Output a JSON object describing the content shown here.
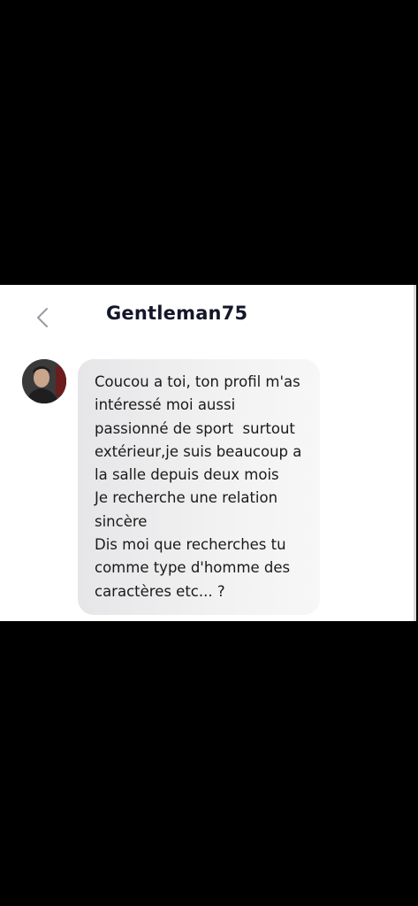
{
  "header": {
    "title": "Gentleman75",
    "back_icon": "chevron-left-icon"
  },
  "colors": {
    "page_background": "#000000",
    "panel_background": "#ffffff",
    "bubble_background": "#eeeeef",
    "title_color": "#14172a",
    "back_icon_color": "#9a9aa2"
  },
  "message": {
    "sender_avatar": "avatar",
    "lines": [
      "Coucou a toi, ton profil m'as",
      "intéressé moi aussi",
      "passionné de sport  surtout",
      "extérieur,je suis beaucoup a",
      "la salle depuis deux mois",
      "Je recherche une relation",
      "sincère",
      "Dis moi que recherches tu",
      "comme type d'homme des",
      "caractères etc... ?"
    ]
  }
}
